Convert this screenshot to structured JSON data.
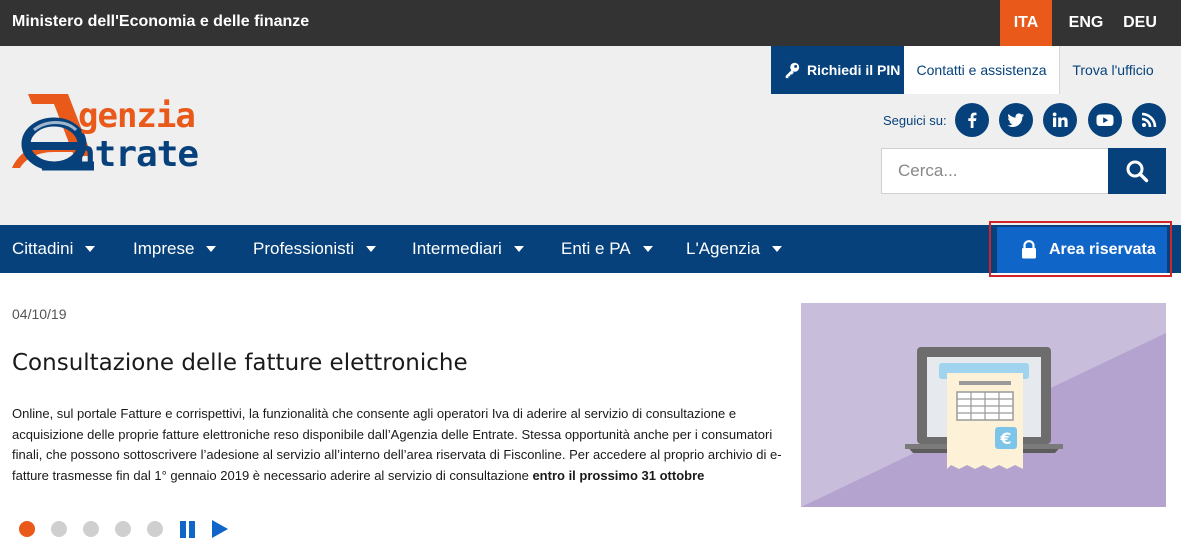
{
  "topbar": {
    "ministry": "Ministero dell'Economia e delle finanze",
    "languages": [
      {
        "code": "ITA",
        "active": true
      },
      {
        "code": "ENG",
        "active": false
      },
      {
        "code": "DEU",
        "active": false
      }
    ]
  },
  "utility": {
    "pin_label": "Richiedi il PIN",
    "contact_label": "Contatti e assistenza",
    "office_label": "Trova l'ufficio"
  },
  "logo": {
    "line1": "genzia",
    "line2": "ntrate"
  },
  "social": {
    "label": "Seguici su:",
    "icons": [
      "facebook-icon",
      "twitter-icon",
      "linkedin-icon",
      "youtube-icon",
      "rss-icon"
    ]
  },
  "search": {
    "placeholder": "Cerca..."
  },
  "nav": {
    "items": [
      "Cittadini",
      "Imprese",
      "Professionisti",
      "Intermediari",
      "Enti e PA",
      "L'Agenzia"
    ],
    "area_label": "Area riservata"
  },
  "article": {
    "date": "04/10/19",
    "title": "Consultazione delle fatture elettroniche",
    "body": "Online, sul portale Fatture e corrispettivi, la funzionalità che consente agli operatori Iva di aderire al servizio di consultazione e acquisizione delle proprie fatture elettroniche reso disponibile dall’Agenzia delle Entrate. Stessa opportunità anche per i consumatori finali, che possono sottoscrivere l’adesione al servizio all’interno dell’area riservata di Fisconline. Per accedere al proprio archivio di e-fatture trasmesse fin dal 1° gennaio 2019 è necessario aderire al servizio di consultazione ",
    "body_bold": "entro il prossimo 31 ottobre"
  },
  "carousel": {
    "slides_total": 5,
    "active_slide": 1,
    "image_symbol": "€"
  },
  "colors": {
    "brand_blue": "#06417b",
    "accent_orange": "#e8591a",
    "button_blue": "#0f65c8",
    "highlight_red": "#d0242b",
    "illustration_purple": "#b4a2cf"
  }
}
